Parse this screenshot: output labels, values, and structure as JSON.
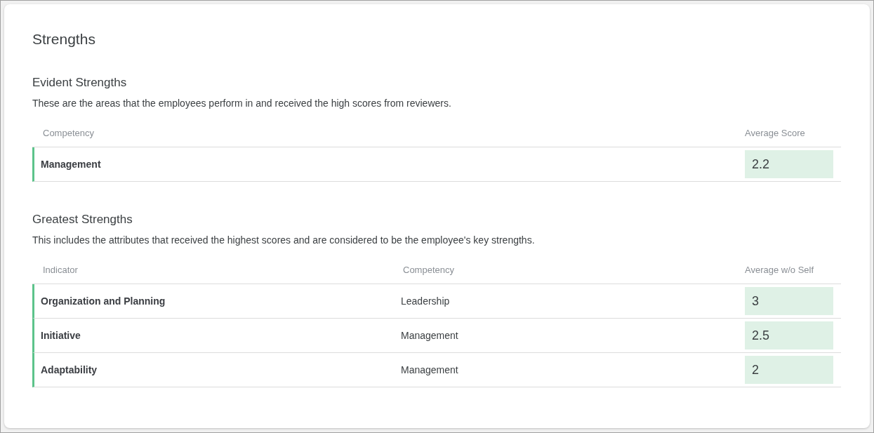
{
  "title": "Strengths",
  "sections": [
    {
      "heading": "Evident Strengths",
      "description": "These are the areas that the employees perform in and received the high scores from reviewers.",
      "columns": [
        "Competency",
        "Average Score"
      ],
      "rows": [
        {
          "cells": [
            "Management"
          ],
          "score": "2.2"
        }
      ]
    },
    {
      "heading": "Greatest Strengths",
      "description": "This includes the attributes that received the highest scores and are considered to be the employee's key strengths.",
      "columns": [
        "Indicator",
        "Competency",
        "Average w/o Self"
      ],
      "rows": [
        {
          "cells": [
            "Organization and Planning",
            "Leadership"
          ],
          "score": "3"
        },
        {
          "cells": [
            "Initiative",
            "Management"
          ],
          "score": "2.5"
        },
        {
          "cells": [
            "Adaptability",
            "Management"
          ],
          "score": "2"
        }
      ]
    }
  ]
}
